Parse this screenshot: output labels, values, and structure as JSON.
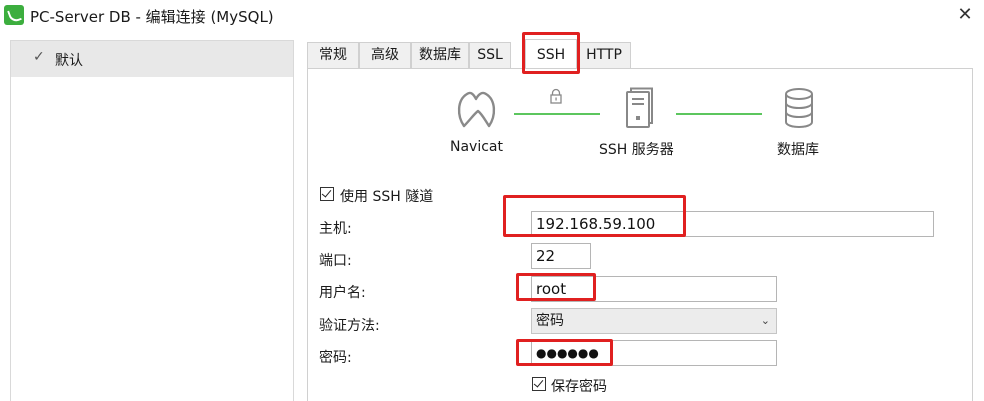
{
  "window": {
    "title": "PC-Server DB - 编辑连接 (MySQL)",
    "close_glyph": "✕"
  },
  "sidebar": {
    "items": [
      {
        "label": "默认",
        "check": "✓"
      }
    ]
  },
  "tabs": [
    {
      "label": "常规"
    },
    {
      "label": "高级"
    },
    {
      "label": "数据库"
    },
    {
      "label": "SSL"
    },
    {
      "label": "SSH"
    },
    {
      "label": "HTTP"
    }
  ],
  "active_tab": "SSH",
  "diagram": {
    "client": "Navicat",
    "server": "SSH 服务器",
    "database": "数据库"
  },
  "ssh": {
    "use_tunnel_label": "使用 SSH 隧道",
    "use_tunnel_checked": true,
    "host_label": "主机:",
    "host_value": "192.168.59.100",
    "port_label": "端口:",
    "port_value": "22",
    "user_label": "用户名:",
    "user_value": "root",
    "auth_label": "验证方法:",
    "auth_value": "密码",
    "password_label": "密码:",
    "password_value": "●●●●●●",
    "save_password_label": "保存密码",
    "save_password_checked": true
  },
  "colors": {
    "connector_line": "#5cc65e",
    "highlight": "#e02020",
    "app_icon": "#3cae3e"
  },
  "icons": [
    "navicat-icon",
    "ssh-server-icon",
    "database-icon",
    "lock-icon",
    "checkmark-icon",
    "chevron-down-icon",
    "close-icon"
  ]
}
